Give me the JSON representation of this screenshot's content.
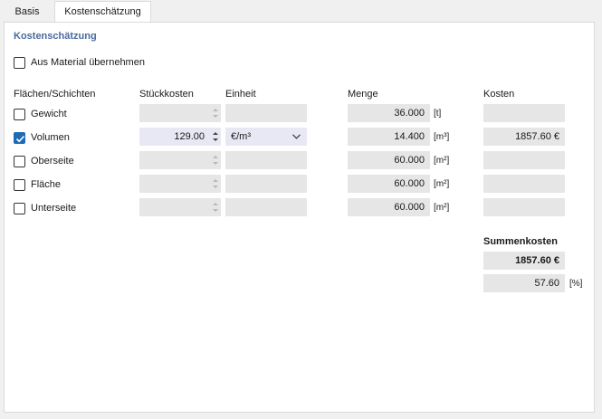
{
  "tabs": [
    {
      "label": "Basis"
    },
    {
      "label": "Kostenschätzung"
    }
  ],
  "section_title": "Kostenschätzung",
  "take_from_material": {
    "label": "Aus Material übernehmen",
    "checked": false
  },
  "headers": {
    "layers": "Flächen/Schichten",
    "unit_cost": "Stückkosten",
    "unit": "Einheit",
    "quantity": "Menge",
    "cost": "Kosten"
  },
  "rows": [
    {
      "label": "Gewicht",
      "checked": false,
      "unit_cost": "",
      "unit": "",
      "quantity": "36.000",
      "quantity_unit": "[t]",
      "cost": ""
    },
    {
      "label": "Volumen",
      "checked": true,
      "unit_cost": "129.00",
      "unit": "€/m³",
      "quantity": "14.400",
      "quantity_unit": "[m³]",
      "cost": "1857.60 €"
    },
    {
      "label": "Oberseite",
      "checked": false,
      "unit_cost": "",
      "unit": "",
      "quantity": "60.000",
      "quantity_unit": "[m²]",
      "cost": ""
    },
    {
      "label": "Fläche",
      "checked": false,
      "unit_cost": "",
      "unit": "",
      "quantity": "60.000",
      "quantity_unit": "[m²]",
      "cost": ""
    },
    {
      "label": "Unterseite",
      "checked": false,
      "unit_cost": "",
      "unit": "",
      "quantity": "60.000",
      "quantity_unit": "[m²]",
      "cost": ""
    }
  ],
  "summary": {
    "title": "Summenkosten",
    "total": "1857.60 €",
    "percent": "57.60",
    "percent_unit": "[%]"
  },
  "colors": {
    "accent": "#1e6ab4",
    "section_title": "#4a6a9c",
    "field_bg": "#e6e6e6",
    "active_field_bg": "#e8e8f4"
  }
}
